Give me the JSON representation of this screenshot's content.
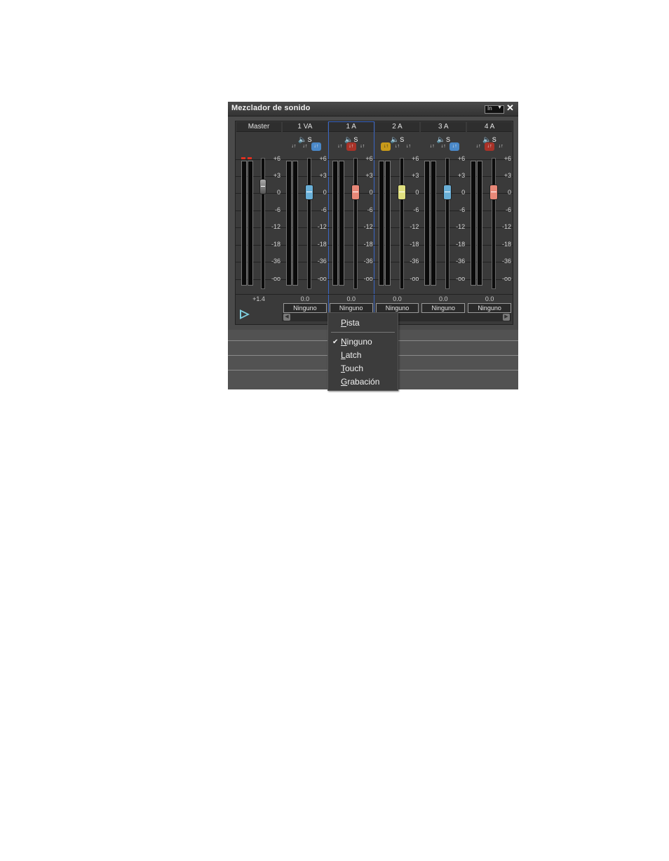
{
  "window": {
    "title": "Mezclador de sonido",
    "title_control_label": "In",
    "close_glyph": "✕"
  },
  "master": {
    "label": "Master",
    "value": "+1.4",
    "fader_level_db": 0
  },
  "scale_ticks": [
    "+6",
    "+3",
    "0",
    "-6",
    "-12",
    "-18",
    "-36",
    "-oo"
  ],
  "channels": [
    {
      "label": "1 VA",
      "value": "0.0",
      "automation": "Ninguno",
      "active_button": 2,
      "button_color": "blue",
      "knob_color": "#6ab0d8",
      "fader_level_db": 0,
      "selected": false
    },
    {
      "label": "1 A",
      "value": "0.0",
      "automation": "Ninguno",
      "active_button": 1,
      "button_color": "red",
      "knob_color": "#e88878",
      "fader_level_db": 0,
      "selected": true
    },
    {
      "label": "2 A",
      "value": "0.0",
      "automation": "Ninguno",
      "active_button": 0,
      "button_color": "yellow",
      "knob_color": "#e0e080",
      "fader_level_db": 0,
      "selected": false
    },
    {
      "label": "3 A",
      "value": "0.0",
      "automation": "Ninguno",
      "active_button": 2,
      "button_color": "blue",
      "knob_color": "#6ab0d8",
      "fader_level_db": 0,
      "selected": false
    },
    {
      "label": "4 A",
      "value": "0.0",
      "automation": "Ninguno",
      "active_button": 1,
      "button_color": "red",
      "knob_color": "#e88878",
      "fader_level_db": 0,
      "selected": false
    }
  ],
  "strip_icons": {
    "speaker": "🔈",
    "solo": "S",
    "button_glyph": "↓↑"
  },
  "play_icon": "play-icon",
  "dropdown": {
    "items": [
      {
        "label": "Pista",
        "underline": "P",
        "rest": "ista",
        "checked": false
      },
      {
        "label": "Ninguno",
        "underline": "N",
        "rest": "inguno",
        "checked": true
      },
      {
        "label": "Latch",
        "underline": "L",
        "rest": "atch",
        "checked": false
      },
      {
        "label": "Touch",
        "underline": "T",
        "rest": "ouch",
        "checked": false
      },
      {
        "label": "Grabación",
        "underline": "G",
        "rest": "rabación",
        "checked": false
      }
    ],
    "check_glyph": "✔"
  }
}
